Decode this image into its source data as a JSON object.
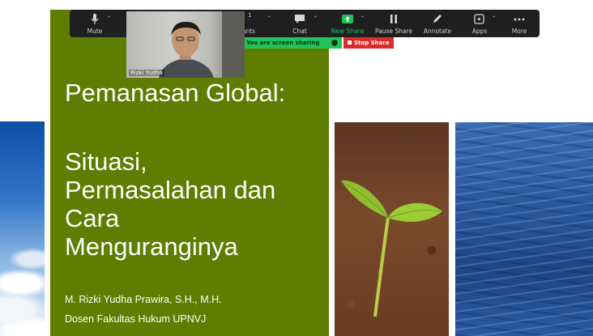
{
  "toolbar": {
    "mute": {
      "label": "Mute",
      "icon": "microphone-icon"
    },
    "participants": {
      "label": "ants",
      "count": "1",
      "icon": "participants-icon"
    },
    "chat": {
      "label": "Chat",
      "icon": "chat-bubble-icon"
    },
    "new_share": {
      "label": "New Share",
      "icon": "share-arrow-icon"
    },
    "pause_share": {
      "label": "Pause Share",
      "icon": "pause-icon"
    },
    "annotate": {
      "label": "Annotate",
      "icon": "pencil-icon"
    },
    "apps": {
      "label": "Apps",
      "icon": "apps-icon"
    },
    "more": {
      "label": "More",
      "icon": "ellipsis-icon"
    }
  },
  "sharing": {
    "banner_text": "You are screen sharing",
    "stop_label": "Stop Share",
    "banner_color": "#1fc35b",
    "stop_color": "#e02a2a"
  },
  "video": {
    "participant_name": "Rizki Yudha"
  },
  "slide": {
    "title": "Pemanasan Global:",
    "subtitle_lines": [
      "Situasi,",
      "Permasalahan dan",
      "Cara",
      "Menguranginya"
    ],
    "author": "M. Rizki Yudha Prawira, S.H., M.H.",
    "affiliation": "Dosen Fakultas Hukum UPNVJ",
    "background_color": "#5d7e00"
  }
}
